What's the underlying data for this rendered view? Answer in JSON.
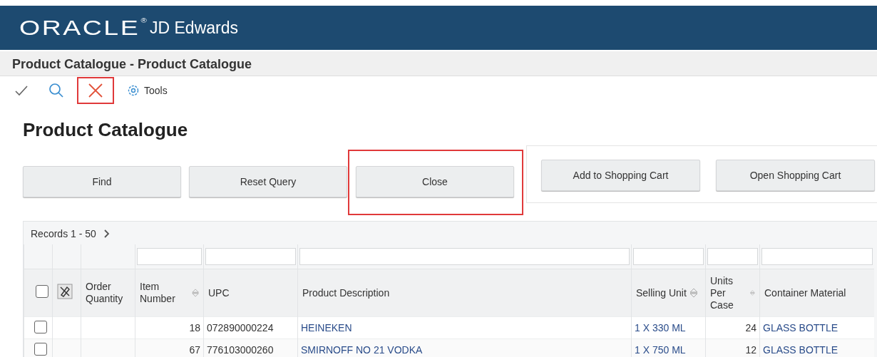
{
  "header": {
    "logo": "ORACLE",
    "trademark": "®",
    "product": "JD Edwards"
  },
  "form_title": "Product Catalogue - Product Catalogue",
  "toolbar": [
    {
      "kind": "ok",
      "highlighted": false
    },
    {
      "kind": "find",
      "highlighted": false
    },
    {
      "kind": "close",
      "highlighted": true
    },
    {
      "kind": "tools",
      "label": "Tools",
      "highlighted": false
    }
  ],
  "heading": "Product Catalogue",
  "buttons": [
    {
      "label": "Find",
      "highlighted": false
    },
    {
      "label": "Reset Query",
      "highlighted": false
    },
    {
      "label": "Close",
      "highlighted": true
    }
  ],
  "cart_buttons": [
    {
      "label": "Add to Shopping Cart"
    },
    {
      "label": "Open Shopping Cart"
    }
  ],
  "grid": {
    "records": "Records 1 - 50",
    "all_checked": false,
    "columns": [
      {
        "label": "Order Quantity",
        "kind": "number",
        "sortable": false,
        "filter": false
      },
      {
        "label": "Item Number",
        "kind": "number",
        "sortable": true,
        "filter": true
      },
      {
        "label": "UPC",
        "kind": "text",
        "sortable": false,
        "filter": true
      },
      {
        "label": "Product Description",
        "kind": "link",
        "sortable": false,
        "filter": true
      },
      {
        "label": "Selling Unit",
        "kind": "link",
        "sortable": true,
        "filter": true
      },
      {
        "label": "Units Per Case",
        "kind": "number",
        "sortable": true,
        "filter": true
      },
      {
        "label": "Container Material",
        "kind": "link",
        "sortable": false,
        "filter": true
      }
    ],
    "rows": [
      {
        "checked": false,
        "cells": [
          null,
          "18",
          "072890000224",
          "HEINEKEN",
          "1 X 330 ML",
          "24",
          "GLASS BOTTLE"
        ]
      },
      {
        "checked": false,
        "cells": [
          null,
          "67",
          "776103000260",
          "SMIRNOFF NO 21 VODKA",
          "1 X 750 ML",
          "12",
          "GLASS BOTTLE"
        ]
      }
    ]
  }
}
